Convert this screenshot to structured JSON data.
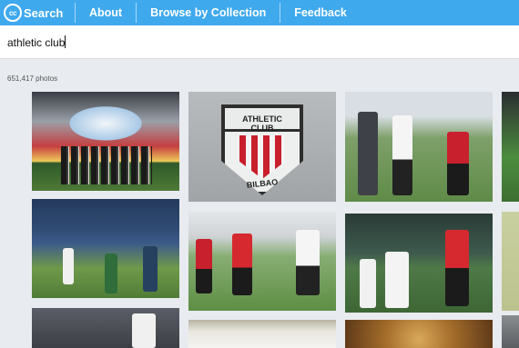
{
  "header": {
    "logo_badge": "cc",
    "logo_text": "Search",
    "nav": [
      "About",
      "Browse by Collection",
      "Feedback"
    ]
  },
  "search": {
    "value": "athletic club"
  },
  "results": {
    "count_text": "651,417 photos"
  },
  "photos": [
    {
      "name": "stadium-group-photo"
    },
    {
      "name": "athletic-club-crest-photo",
      "crest_name": "ATHLETIC CLUB",
      "crest_city": "BILBAO"
    },
    {
      "name": "referee-match-photo"
    },
    {
      "name": "cropped-photo-right-1"
    },
    {
      "name": "youth-football-photo"
    },
    {
      "name": "match-action-photo-1"
    },
    {
      "name": "match-action-photo-2"
    },
    {
      "name": "cropped-photo-right-2"
    },
    {
      "name": "crowd-photo"
    },
    {
      "name": "bottom-photo-2"
    },
    {
      "name": "bottom-photo-3"
    },
    {
      "name": "cropped-photo-right-3"
    }
  ],
  "colors": {
    "header_bg": "#3fa9ed",
    "page_bg": "#e8ebef",
    "crest_red": "#c81f2c"
  }
}
